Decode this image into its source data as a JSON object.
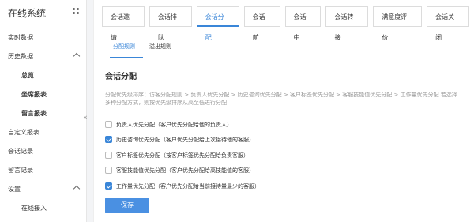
{
  "app": {
    "title": "在线系统",
    "brand_icon": "grid-dots-icon"
  },
  "sidebar": {
    "items": [
      {
        "label": "实时数据"
      },
      {
        "label": "历史数据"
      },
      {
        "label": "总览"
      },
      {
        "label": "坐席报表"
      },
      {
        "label": "留言报表"
      },
      {
        "label": "自定义报表"
      },
      {
        "label": "会话记录"
      },
      {
        "label": "留言记录"
      },
      {
        "label": "设置"
      },
      {
        "label": "在线接入"
      }
    ],
    "collapse_glyph": "«"
  },
  "tabs": [
    {
      "label": "会话邀请"
    },
    {
      "label": "会话排队"
    },
    {
      "label": "会话分配"
    },
    {
      "label": "会话前"
    },
    {
      "label": "会话中"
    },
    {
      "label": "会话转接"
    },
    {
      "label": "满意度评价"
    },
    {
      "label": "会话关闭"
    }
  ],
  "subtabs": [
    {
      "label": "分配规则"
    },
    {
      "label": "溢出规则"
    }
  ],
  "section": {
    "title": "会话分配",
    "description": "分配优先级排序：访客分配规则 > 负责人优先分配 > 历史咨询优先分配 > 客户标签优先分配 > 客服技能值优先分配 > 工作量优先分配 若选择多种分配方式，则按优先级排序从高至低进行分配"
  },
  "options": [
    {
      "label": "负责人优先分配（客户优先分配给他的负责人）",
      "checked": false
    },
    {
      "label": "历史咨询优先分配（客户优先分配给上次接待他的客服）",
      "checked": true
    },
    {
      "label": "客户标签优先分配（按客户标签优先分配给负责客服）",
      "checked": false
    },
    {
      "label": "客服技能值优先分配（客户优先分配给高技能值的客服）",
      "checked": false
    },
    {
      "label": "工作量优先分配（客户优先分配给当前接待量最少的客服）",
      "checked": true
    }
  ],
  "actions": {
    "save_label": "保存"
  },
  "colors": {
    "accent": "#3a86d8",
    "button": "#4a90e2"
  }
}
